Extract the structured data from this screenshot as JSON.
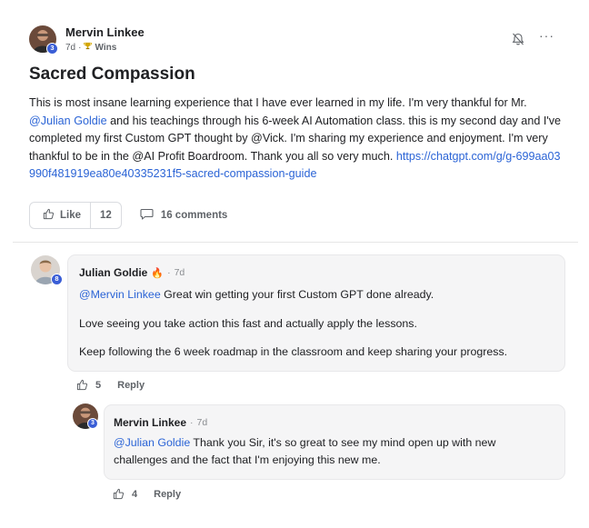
{
  "post": {
    "author": "Mervin Linkee",
    "author_level": "3",
    "time": "7d",
    "separator": "·",
    "category": "Wins",
    "title": "Sacred Compassion",
    "body_part1": "This is most insane learning experience that I have ever learned in my life. I'm very thankful for Mr. ",
    "mention": "@Julian Goldie",
    "body_part2": " and his teachings through his 6-week AI Automation class. this is my second day and I've completed my first Custom GPT thought by @Vick. I'm sharing my experience and enjoyment. I'm very thankful to be in the @AI Profit Boardroom. Thank you all so very much. ",
    "link": "https://chatgpt.com/g/g-699aa03990f481919ea80e40335231f5-sacred-compassion-guide",
    "more_icon": "···"
  },
  "actions": {
    "like_label": "Like",
    "like_count": "12",
    "comments_label": "16 comments"
  },
  "comments": [
    {
      "author": "Julian Goldie",
      "author_level": "8",
      "flair": "🔥",
      "separator": "·",
      "time": "7d",
      "mention": "@Mervin Linkee",
      "line1_rest": " Great win getting your first Custom GPT done already.",
      "line2": "Love seeing you take action this fast and actually apply the lessons.",
      "line3": "Keep following the 6 week roadmap in the classroom and keep sharing your progress.",
      "likes": "5",
      "reply_label": "Reply"
    },
    {
      "author": "Mervin Linkee",
      "author_level": "3",
      "separator": "·",
      "time": "7d",
      "mention": "@Julian Goldie",
      "text_rest": " Thank you Sir, it's so great to see my mind open up with new challenges and the fact that I'm enjoying this new me.",
      "likes": "4",
      "reply_label": "Reply"
    }
  ],
  "colors": {
    "link": "#2b64d6",
    "level_badge": "#3a5ed6",
    "comment_bg": "#f5f5f6"
  }
}
